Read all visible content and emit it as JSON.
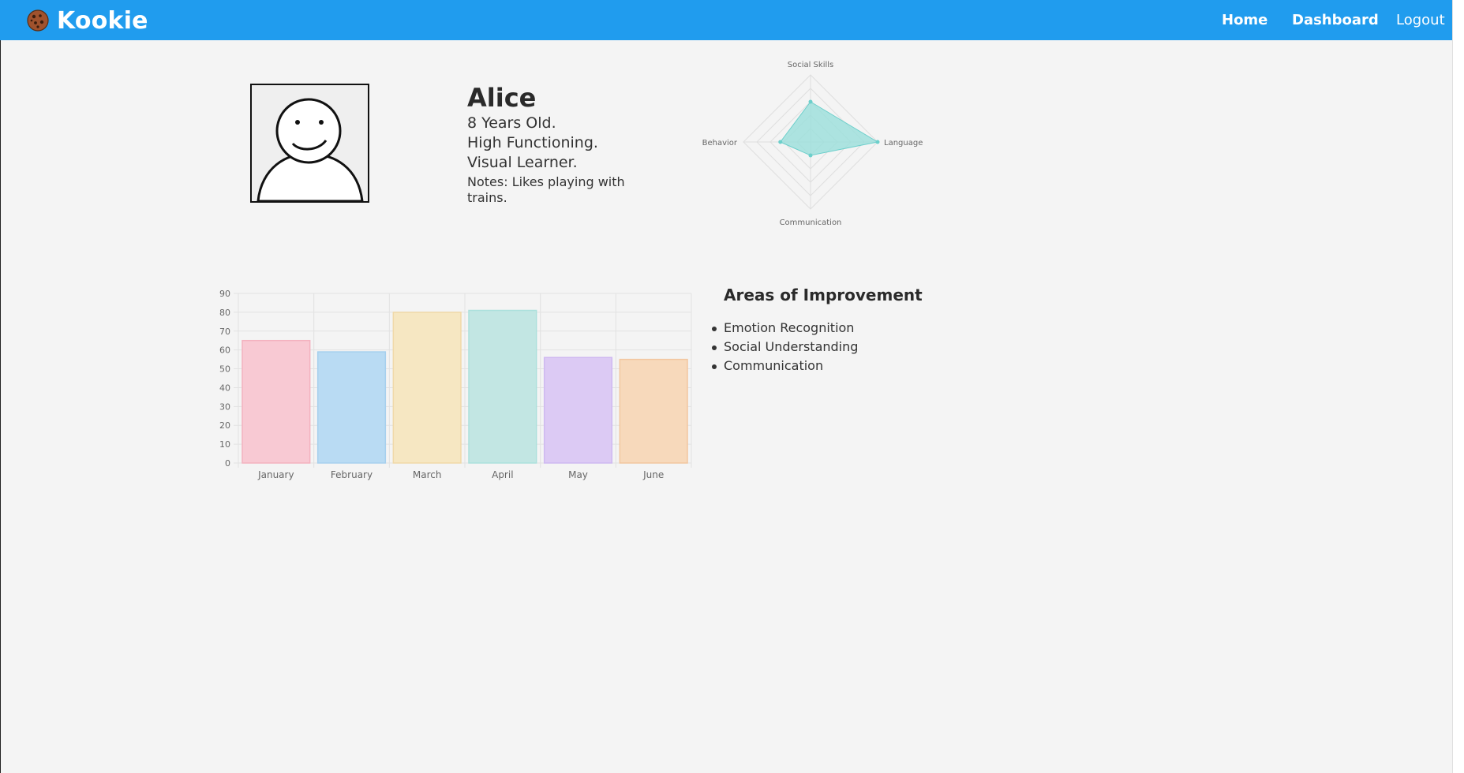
{
  "app": {
    "brand": "Kookie",
    "icon": "cookie-icon"
  },
  "nav": {
    "home": "Home",
    "dashboard": "Dashboard",
    "logout": "Logout"
  },
  "profile": {
    "name": "Alice",
    "age": "8 Years Old.",
    "functioning": "High Functioning.",
    "learner": "Visual Learner.",
    "notes": "Notes: Likes playing with trains."
  },
  "improvement": {
    "title": "Areas of Improvement",
    "items": [
      "Emotion Recognition",
      "Social Understanding",
      "Communication"
    ]
  },
  "colors": {
    "navbar": "#209cee",
    "radar_fill": "#9fdfdc",
    "radar_stroke": "#6ccfcb"
  },
  "chart_data": [
    {
      "type": "radar",
      "labels": [
        "Social Skills",
        "Language",
        "Communication",
        "Behavior"
      ],
      "values": [
        6,
        10,
        2,
        4.5
      ],
      "max": 10,
      "grid": true
    },
    {
      "type": "bar",
      "categories": [
        "January",
        "February",
        "March",
        "April",
        "May",
        "June"
      ],
      "values": [
        65,
        59,
        80,
        81,
        56,
        55
      ],
      "ylim": [
        0,
        90
      ],
      "yticks": [
        0,
        10,
        20,
        30,
        40,
        50,
        60,
        70,
        80,
        90
      ],
      "bar_colors": [
        "#f8c9d3",
        "#b9dbf3",
        "#f6e7c2",
        "#c2e6e3",
        "#dccaf4",
        "#f7d9bb"
      ],
      "bar_borders": [
        "#f3b2bf",
        "#a7d0ee",
        "#f0d9a8",
        "#ace0dc",
        "#cfb9f1",
        "#f2c69f"
      ],
      "grid": true
    }
  ]
}
